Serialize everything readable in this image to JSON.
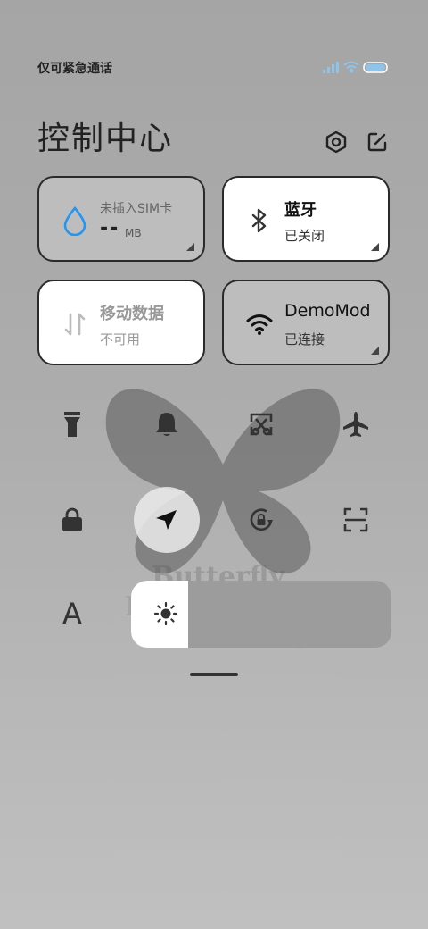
{
  "status_bar": {
    "carrier_text": "仅可紧急通话"
  },
  "header": {
    "title": "控制中心"
  },
  "tiles": {
    "data_usage": {
      "title": "未插入SIM卡",
      "value": "--",
      "unit": "MB"
    },
    "bluetooth": {
      "title": "蓝牙",
      "status": "已关闭"
    },
    "mobile_data": {
      "title": "移动数据",
      "status": "不可用"
    },
    "wifi": {
      "title": "DemoMod",
      "status": "已连接"
    }
  },
  "quick_buttons": [
    {
      "icon": "flashlight-icon"
    },
    {
      "icon": "bell-icon"
    },
    {
      "icon": "screenshot-icon"
    },
    {
      "icon": "airplane-icon"
    },
    {
      "icon": "lock-icon"
    },
    {
      "icon": "location-icon",
      "active": true
    },
    {
      "icon": "rotation-lock-icon"
    },
    {
      "icon": "scan-icon"
    }
  ],
  "font_button": {
    "label": "A"
  },
  "brightness": {
    "level": 0.22
  },
  "colors": {
    "tile_dim": "#bdbdbd",
    "tile_active": "#ffffff",
    "accent_blue": "#2196f3"
  }
}
